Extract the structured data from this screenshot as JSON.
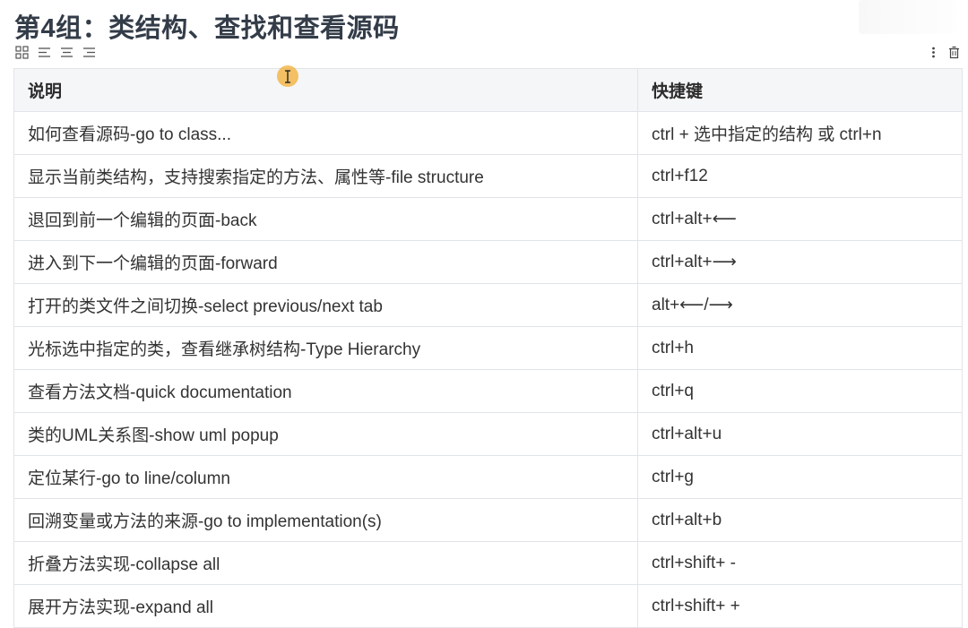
{
  "page": {
    "title": "第4组：类结构、查找和查看源码"
  },
  "toolbar": {
    "icons": [
      "table-grid-icon",
      "align-left-icon",
      "align-center-icon",
      "align-right-icon"
    ],
    "right_icons": [
      "more-vertical-icon",
      "delete-icon"
    ]
  },
  "table": {
    "headers": [
      "说明",
      "快捷键"
    ],
    "rows": [
      [
        "如何查看源码-go to class...",
        "ctrl + 选中指定的结构 或 ctrl+n"
      ],
      [
        "显示当前类结构，支持搜索指定的方法、属性等-file structure",
        "ctrl+f12"
      ],
      [
        "退回到前一个编辑的页面-back",
        "ctrl+alt+⟵"
      ],
      [
        "进入到下一个编辑的页面-forward",
        "ctrl+alt+⟶"
      ],
      [
        "打开的类文件之间切换-select previous/next tab",
        "alt+⟵/⟶"
      ],
      [
        "光标选中指定的类，查看继承树结构-Type Hierarchy",
        "ctrl+h"
      ],
      [
        "查看方法文档-quick documentation",
        "ctrl+q"
      ],
      [
        "类的UML关系图-show uml popup",
        "ctrl+alt+u"
      ],
      [
        "定位某行-go to line/column",
        "ctrl+g"
      ],
      [
        "回溯变量或方法的来源-go to implementation(s)",
        "ctrl+alt+b"
      ],
      [
        "折叠方法实现-collapse all",
        "ctrl+shift+ -"
      ],
      [
        "展开方法实现-expand all",
        "ctrl+shift+ +"
      ]
    ]
  },
  "colors": {
    "title": "#333c48",
    "header_bg": "#f5f6f8",
    "border": "#e1e4e8",
    "cursor_highlight": "#f2ad33"
  }
}
